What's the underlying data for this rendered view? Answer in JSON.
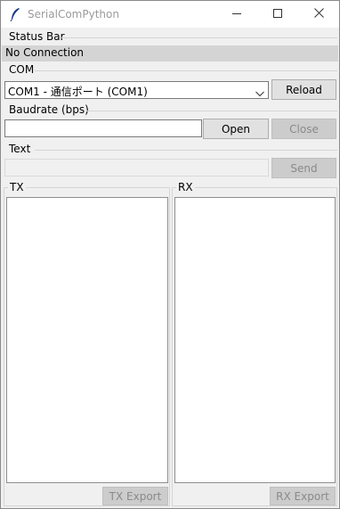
{
  "window": {
    "title": "SerialComPython",
    "buttons": {
      "minimize": "minimize-icon",
      "maximize": "maximize-icon",
      "close": "close-icon"
    }
  },
  "status": {
    "label": "Status Bar",
    "value": "No Connection"
  },
  "com": {
    "label": "COM",
    "selected": "COM1 - 通信ポート (COM1)",
    "reload_label": "Reload"
  },
  "baudrate": {
    "label": "Baudrate (bps)",
    "value": "",
    "open_label": "Open",
    "close_label": "Close"
  },
  "text": {
    "label": "Text",
    "value": "",
    "send_label": "Send"
  },
  "tx": {
    "label": "TX",
    "content": "",
    "export_label": "TX Export"
  },
  "rx": {
    "label": "RX",
    "content": "",
    "export_label": "RX Export"
  },
  "colors": {
    "status_bg": "#d4d4d4",
    "window_bg": "#f0f0f0",
    "disabled_btn": "#cccccc"
  }
}
